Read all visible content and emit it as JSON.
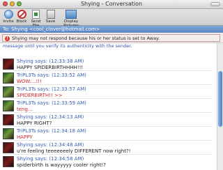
{
  "window": {
    "title": "Shying - Conversation"
  },
  "toolbar": {
    "items": [
      {
        "label": "Invite",
        "icon": "invite-icon"
      },
      {
        "label": "Block",
        "icon": "block-icon"
      },
      {
        "label": "Send File",
        "icon": "send-file-icon"
      },
      {
        "label": "Save",
        "icon": "save-icon"
      },
      {
        "label": "Display Pictures",
        "icon": "display-pictures-icon"
      }
    ]
  },
  "to": {
    "label": "To: Shying",
    "address": "<cool_clover@hotmail.com>"
  },
  "warning": {
    "text": "Shying may not respond because his or her status is set to Away."
  },
  "notice": {
    "text": "message until you verify its authenticity with the sender."
  },
  "messages": [
    {
      "sender": "Shying",
      "time": "(12:33:38 AM)",
      "header": "Shying says: (12:33:38 AM)",
      "text": "HAPPY SPIDERBIRTHHHH!!!",
      "style": "dark",
      "avatar": "avatar-shying"
    },
    {
      "sender": "TriPL3Ts",
      "time": "(12:33:52 AM)",
      "header": "TriPL3Ts says: (12:33:52 AM)",
      "text": "WOW....!!!",
      "style": "red",
      "avatar": "avatar-triplets"
    },
    {
      "sender": "TriPL3Ts",
      "time": "(12:33:57 AM)",
      "header": "TriPL3Ts says: (12:33:57 AM)",
      "text": "SPIDERBIRTH!! >>",
      "style": "red",
      "avatar": "avatar-triplets"
    },
    {
      "sender": "TriPL3Ts",
      "time": "(12:33:59 AM)",
      "header": "TriPL3Ts says: (12:33:59 AM)",
      "text": "teng...",
      "style": "red",
      "avatar": "avatar-triplets"
    },
    {
      "sender": "Shying",
      "time": "(12:34:13 AM)",
      "header": "Shying says: (12:34:13 AM)",
      "text": "HAPPY RIGHT?",
      "style": "dark",
      "avatar": "avatar-shying"
    },
    {
      "sender": "TriPL3Ts",
      "time": "(12:34:18 AM)",
      "header": "TriPL3Ts says: (12:34:18 AM)",
      "text": "HAPPY",
      "style": "red",
      "avatar": "avatar-triplets"
    },
    {
      "sender": "Shying",
      "time": "(12:34:48 AM)",
      "header": "Shying says: (12:34:48 AM)",
      "text": "u're feeling teeeeeeely DIFFERENT now right?!",
      "style": "dark",
      "avatar": "avatar-shying"
    },
    {
      "sender": "Shying",
      "time": "(12:34:58 AM)",
      "header": "Shying says: (12:34:58 AM)",
      "text": "spiderbirth is wayyyyy cooler right!?",
      "style": "dark",
      "avatar": "avatar-shying"
    }
  ],
  "colors": {
    "to_bar": "#6b94cc",
    "sender": "#3a5fb0",
    "red_text": "#d2282b",
    "warning_border": "#cc9999"
  }
}
